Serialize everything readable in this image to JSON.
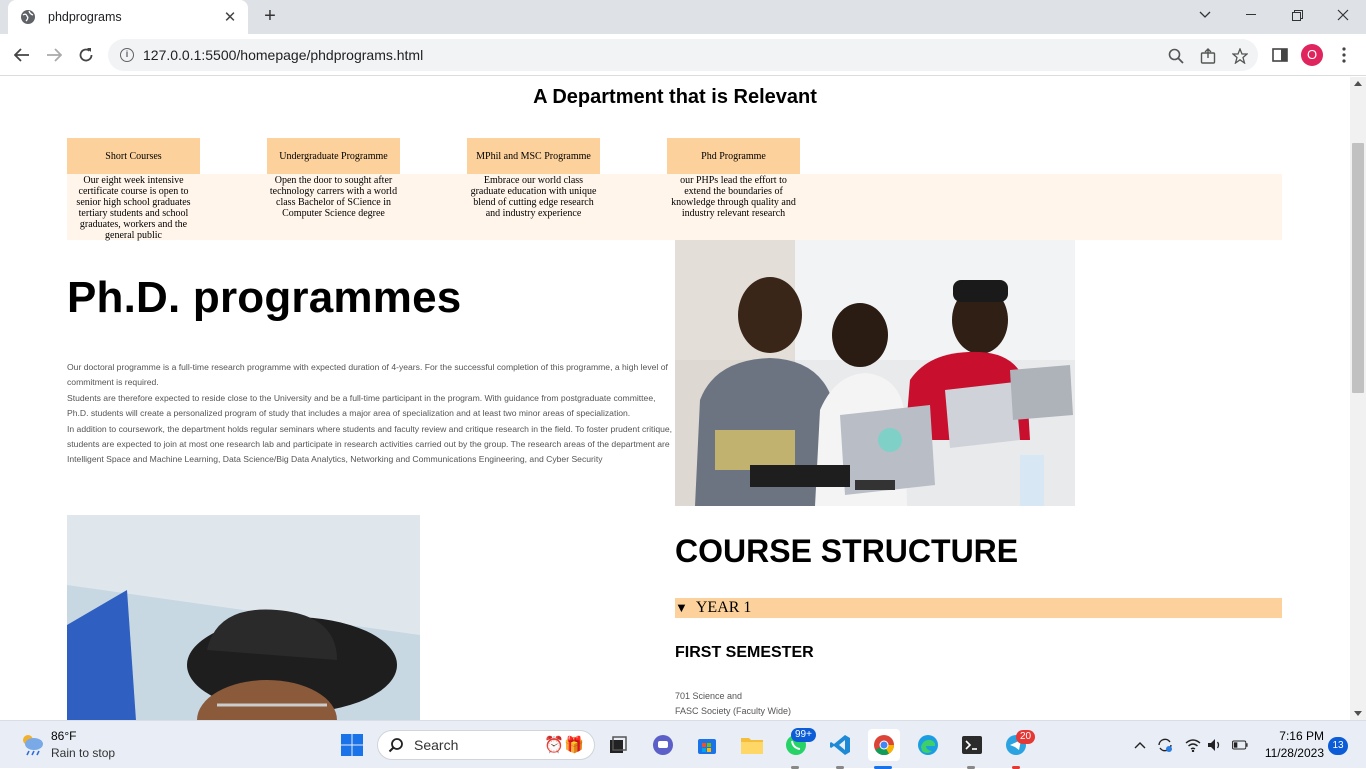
{
  "browser": {
    "tab_title": "phdprograms",
    "url": "127.0.0.1:5500/homepage/phdprograms.html",
    "profile_initial": "O",
    "accent": "#e0245e"
  },
  "page": {
    "department_heading": "A Department that is Relevant",
    "cards": [
      {
        "title": "Short Courses",
        "body": "Our eight week intensive certificate course is open to senior high school graduates tertiary students and school graduates, workers and the general public"
      },
      {
        "title": "Undergraduate Programme",
        "body": "Open the door to sought after technology carrers with a world class Bachelor of SCience in Computer Science degree"
      },
      {
        "title": "MPhil and MSC Programme",
        "body": "Embrace our world class graduate education with unique blend of cutting edge research and industry experience"
      },
      {
        "title": "Phd Programme",
        "body": "our PHPs lead the effort to extend the boundaries of knowledge through quality and industry relevant research"
      }
    ],
    "phd_title": "Ph.D. programmes",
    "phd_paragraphs": [
      "Our doctoral programme is a full-time research programme with expected duration of 4-years. For the successful completion of this programme, a high level of commitment is required.",
      "Students are therefore expected to reside close to the University and be a full-time participant in the program. With guidance from postgraduate committee, Ph.D. students will create a personalized program of study that includes a major area of specialization and at least two minor areas of specialization.",
      "In addition to coursework, the department holds regular seminars where students and faculty review and critique research in the field. To foster prudent critique, students are expected to join at most one research lab and participate in research activities carried out by the group. The research areas of the department are Intelligent Space and Machine Learning, Data Science/Big Data Analytics, Networking and Communications Engineering, and Cyber Security"
    ],
    "course_structure_title": "COURSE STRUCTURE",
    "year_label": "YEAR 1",
    "semester_title": "FIRST SEMESTER",
    "courses": [
      "701 Science and",
      "FASC Society (Faculty Wide)"
    ],
    "colors": {
      "card_header": "#fdd19b",
      "card_band": "#fff5eb",
      "year_bar": "#fdd19b"
    }
  },
  "taskbar": {
    "temperature": "86°F",
    "weather": "Rain to stop",
    "search_label": "Search",
    "whatsapp_badge": "99+",
    "telegram_badge": "20",
    "time": "7:16 PM",
    "date": "11/28/2023",
    "notifications": "13"
  }
}
